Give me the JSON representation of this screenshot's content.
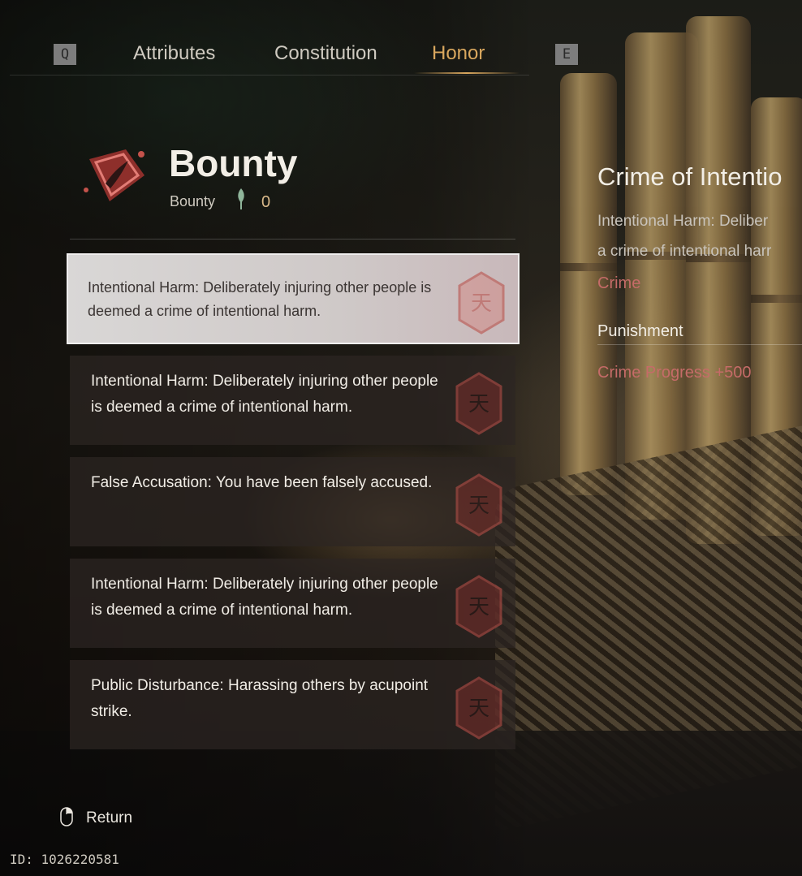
{
  "tabs": {
    "prev_key": "Q",
    "next_key": "E",
    "items": [
      {
        "label": "Attributes"
      },
      {
        "label": "Constitution"
      },
      {
        "label": "Honor"
      }
    ],
    "active_index": 2
  },
  "header": {
    "title": "Bounty",
    "sub_label": "Bounty",
    "sub_value": "0",
    "emblem_icon": "bounty-emblem-icon"
  },
  "crimes": [
    {
      "text": "Intentional Harm: Deliberately injuring other people is deemed a crime of intentional harm.",
      "selected": true
    },
    {
      "text": "Intentional Harm: Deliberately injuring other people is deemed a crime of intentional harm.",
      "selected": false
    },
    {
      "text": "False Accusation: You have been falsely accused.",
      "selected": false
    },
    {
      "text": "Intentional Harm: Deliberately injuring other people is deemed a crime of intentional harm.",
      "selected": false
    },
    {
      "text": "Public Disturbance: Harassing others by acupoint strike.",
      "selected": false
    }
  ],
  "detail": {
    "title": "Crime of Intentio",
    "description": "Intentional Harm: Deliber a crime of intentional harr",
    "category": "Crime",
    "punishment_label": "Punishment",
    "punishment_value": "Crime Progress +500"
  },
  "footer": {
    "return_label": "Return",
    "uid": "ID: 1026220581"
  },
  "colors": {
    "accent": "#d9a75e",
    "crime_red": "#c56b68",
    "seal_red": "#b8463f"
  }
}
